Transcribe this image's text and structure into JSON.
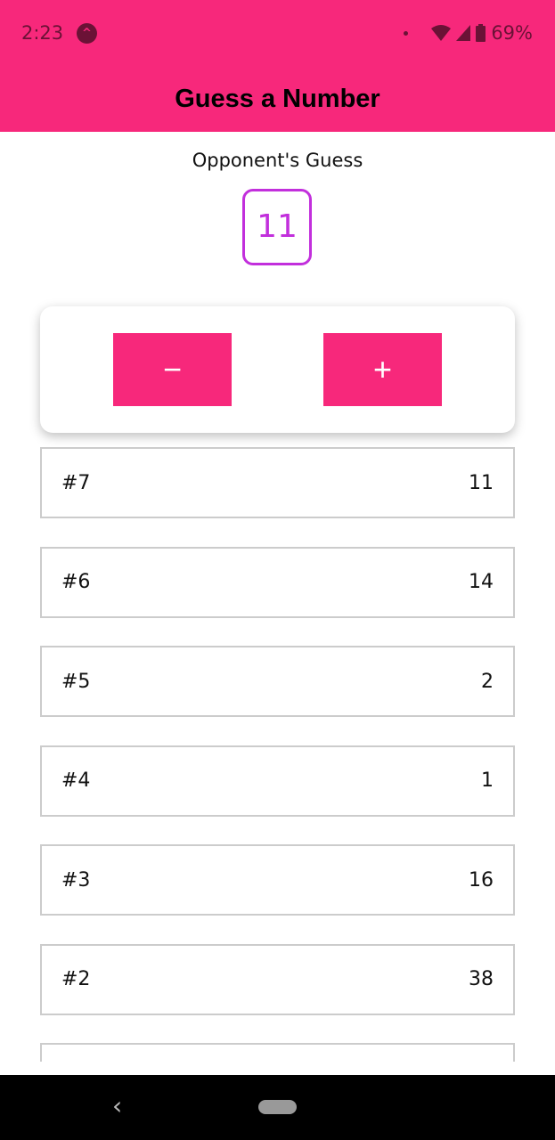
{
  "status_bar": {
    "time": "2:23",
    "battery": "69%"
  },
  "header": {
    "title": "Guess a Number"
  },
  "guess": {
    "label": "Opponent's Guess",
    "value": "11"
  },
  "controls": {
    "lower": "−",
    "higher": "+"
  },
  "rounds": [
    {
      "round": "#7",
      "value": "11"
    },
    {
      "round": "#6",
      "value": "14"
    },
    {
      "round": "#5",
      "value": "2"
    },
    {
      "round": "#4",
      "value": "1"
    },
    {
      "round": "#3",
      "value": "16"
    },
    {
      "round": "#2",
      "value": "38"
    },
    {
      "round": "",
      "value": ""
    }
  ],
  "colors": {
    "primary": "#f7287b",
    "accent": "#c22fdc"
  }
}
